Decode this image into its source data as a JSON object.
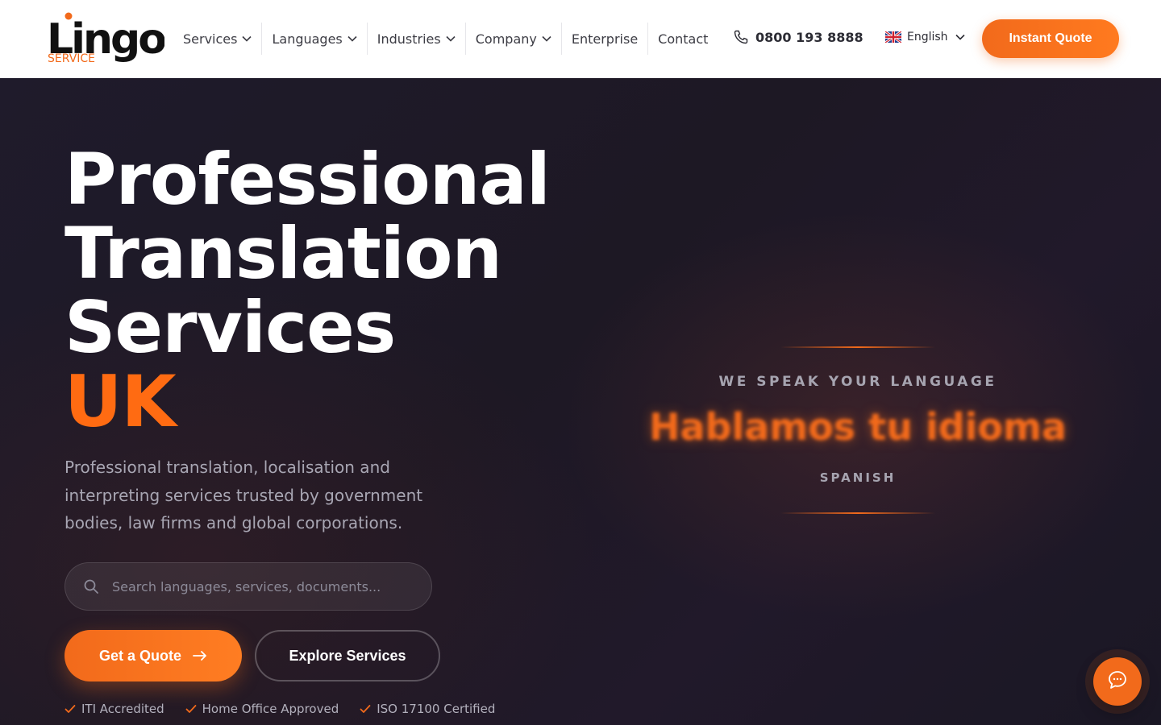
{
  "brand": {
    "logo_word": "Lingo",
    "logo_sub": "SERVICE",
    "colors": {
      "accent": "#f26a1b",
      "hero_bg": "#1f1b2b",
      "text_dark": "#3c3c44"
    }
  },
  "nav": {
    "items": [
      {
        "label": "Services",
        "has_dropdown": true
      },
      {
        "label": "Languages",
        "has_dropdown": true
      },
      {
        "label": "Industries",
        "has_dropdown": true
      },
      {
        "label": "Company",
        "has_dropdown": true
      },
      {
        "label": "Enterprise",
        "has_dropdown": false
      },
      {
        "label": "Contact",
        "has_dropdown": false
      }
    ],
    "phone": "0800 193 8888",
    "language": {
      "label": "English",
      "flag": "uk-flag-icon"
    },
    "cta": "Instant Quote"
  },
  "hero": {
    "title_lines": [
      "Professional",
      "Translation",
      "Services"
    ],
    "title_accent": "UK",
    "subtitle": "Professional translation, localisation and interpreting services trusted by government bodies, law firms and global corporations.",
    "search_placeholder": "Search languages, services, documents...",
    "primary_cta": "Get a Quote",
    "secondary_cta": "Explore Services",
    "badges": [
      "ITI Accredited",
      "Home Office Approved",
      "ISO 17100 Certified"
    ]
  },
  "showcase": {
    "tagline": "WE SPEAK YOUR LANGUAGE",
    "phrase": "Hablamos tu idioma",
    "language": "SPANISH"
  },
  "chat": {
    "icon": "chat-bubble-icon"
  }
}
